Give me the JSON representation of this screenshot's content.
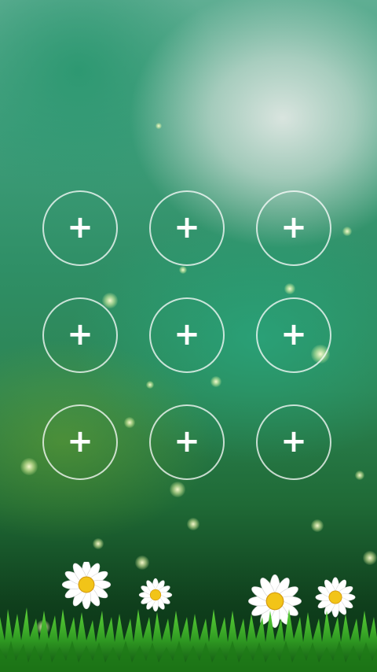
{
  "lock_screen": {
    "pattern_dots": [
      {
        "id": "1",
        "symbol": "+"
      },
      {
        "id": "2",
        "symbol": "+"
      },
      {
        "id": "3",
        "symbol": "+"
      },
      {
        "id": "4",
        "symbol": "+"
      },
      {
        "id": "5",
        "symbol": "+"
      },
      {
        "id": "6",
        "symbol": "+"
      },
      {
        "id": "7",
        "symbol": "+"
      },
      {
        "id": "8",
        "symbol": "+"
      },
      {
        "id": "9",
        "symbol": "+"
      }
    ],
    "wallpaper": {
      "description_icon": "daisy-meadow-wallpaper",
      "colors": {
        "glow": "#dfe7e3",
        "teal": "#3e9d7a",
        "green": "#2c8453",
        "dark_green": "#0f3f1c",
        "petal": "#ffffff",
        "flower_center": "#f2c418"
      }
    }
  }
}
